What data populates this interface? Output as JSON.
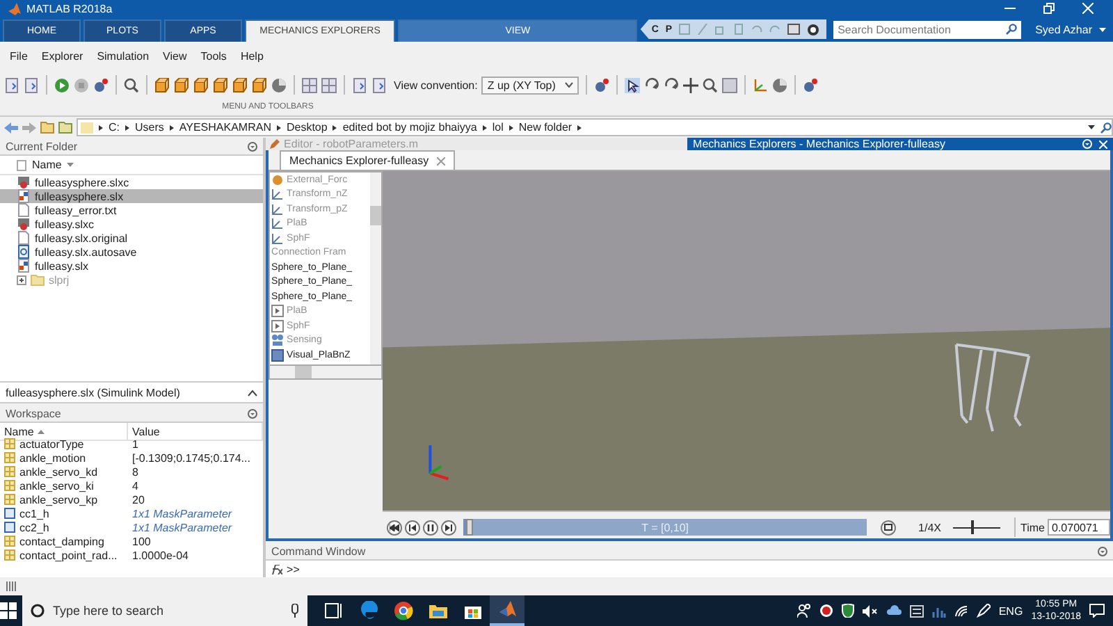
{
  "window": {
    "title": "MATLAB R2018a"
  },
  "ribbon_tabs": [
    {
      "label": "HOME",
      "selected": false
    },
    {
      "label": "PLOTS",
      "selected": false
    },
    {
      "label": "APPS",
      "selected": false
    },
    {
      "label": "MECHANICS EXPLORERS",
      "selected": true
    },
    {
      "label": "VIEW",
      "selected": false
    }
  ],
  "quick_access": [
    "C",
    "P"
  ],
  "search": {
    "placeholder": "Search Documentation"
  },
  "user": "Syed Azhar",
  "menu": [
    "File",
    "Explorer",
    "Simulation",
    "View",
    "Tools",
    "Help"
  ],
  "toolbar": {
    "view_convention_label": "View convention:",
    "view_convention_value": "Z up (XY Top)",
    "section_label": "MENU AND TOOLBARS"
  },
  "address_bar": {
    "path": [
      "C:",
      "Users",
      "AYESHAKAMRAN",
      "Desktop",
      "edited bot by mojiz bhaiyya",
      "lol",
      "New folder"
    ]
  },
  "current_folder": {
    "title": "Current Folder",
    "column": "Name",
    "files": [
      {
        "name": "fulleasysphere.slxc",
        "kind": "cache",
        "selected": false
      },
      {
        "name": "fulleasysphere.slx",
        "kind": "model",
        "selected": true
      },
      {
        "name": "fulleasy_error.txt",
        "kind": "text",
        "selected": false
      },
      {
        "name": "fulleasy.slxc",
        "kind": "cache",
        "selected": false
      },
      {
        "name": "fulleasy.slx.original",
        "kind": "text",
        "selected": false
      },
      {
        "name": "fulleasy.slx.autosave",
        "kind": "autosave",
        "selected": false
      },
      {
        "name": "fulleasy.slx",
        "kind": "model",
        "selected": false
      },
      {
        "name": "slprj",
        "kind": "folder",
        "selected": false
      }
    ],
    "details": "fulleasysphere.slx  (Simulink Model)"
  },
  "workspace": {
    "title": "Workspace",
    "columns": [
      "Name",
      "Value"
    ],
    "rows": [
      {
        "name": "actuatorType",
        "value": "1",
        "kind": "array"
      },
      {
        "name": "ankle_motion",
        "value": "[-0.1309;0.1745;0.174...",
        "kind": "array"
      },
      {
        "name": "ankle_servo_kd",
        "value": "8",
        "kind": "array"
      },
      {
        "name": "ankle_servo_ki",
        "value": "4",
        "kind": "array"
      },
      {
        "name": "ankle_servo_kp",
        "value": "20",
        "kind": "array"
      },
      {
        "name": "cc1_h",
        "value": "1x1 MaskParameter",
        "kind": "object"
      },
      {
        "name": "cc2_h",
        "value": "1x1 MaskParameter",
        "kind": "object"
      },
      {
        "name": "contact_damping",
        "value": "100",
        "kind": "array"
      },
      {
        "name": "contact_point_rad...",
        "value": "1.0000e-04",
        "kind": "array"
      }
    ]
  },
  "editor_tab": {
    "title": "Editor - robotParameters.m"
  },
  "explorer": {
    "title": "Mechanics Explorers - Mechanics Explorer-fulleasy",
    "tab": "Mechanics Explorer-fulleasy",
    "tree": [
      {
        "label": "External_Forc",
        "kind": "force",
        "greyed": true
      },
      {
        "label": "Transform_nZ",
        "kind": "frame",
        "greyed": true
      },
      {
        "label": "Transform_pZ",
        "kind": "frame",
        "greyed": true
      },
      {
        "label": "PlaB",
        "kind": "frame",
        "greyed": true
      },
      {
        "label": "SphF",
        "kind": "frame",
        "greyed": true
      },
      {
        "label": "Connection Fram",
        "kind": "header",
        "greyed": true
      },
      {
        "label": "Sphere_to_Plane_",
        "kind": "plain",
        "greyed": false
      },
      {
        "label": "Sphere_to_Plane_",
        "kind": "plain",
        "greyed": false
      },
      {
        "label": "Sphere_to_Plane_",
        "kind": "plain",
        "greyed": false
      },
      {
        "label": "PlaB",
        "kind": "port",
        "greyed": true
      },
      {
        "label": "SphF",
        "kind": "port",
        "greyed": true
      },
      {
        "label": "Sensing",
        "kind": "sensing",
        "greyed": true
      },
      {
        "label": "Visual_PlaBnZ",
        "kind": "visual",
        "greyed": false
      }
    ],
    "playback": {
      "range": "T = [0,10]",
      "level": 0.01,
      "speed": "1/4X",
      "speed_slider": {
        "level": 0.4
      },
      "time_label": "Time",
      "time_value": "0.070071"
    }
  },
  "command_window": {
    "title": "Command Window",
    "prompt": ">>"
  },
  "taskbar": {
    "search_placeholder": "Type here to search",
    "apps": [
      {
        "kind": "taskview",
        "selected": false
      },
      {
        "kind": "edge",
        "selected": false
      },
      {
        "kind": "chrome",
        "selected": false
      },
      {
        "kind": "folder",
        "selected": false
      },
      {
        "kind": "store",
        "selected": false
      },
      {
        "kind": "matlab",
        "selected": true
      }
    ],
    "language": "ENG",
    "time": "10:55 PM",
    "date": "13-10-2018"
  }
}
